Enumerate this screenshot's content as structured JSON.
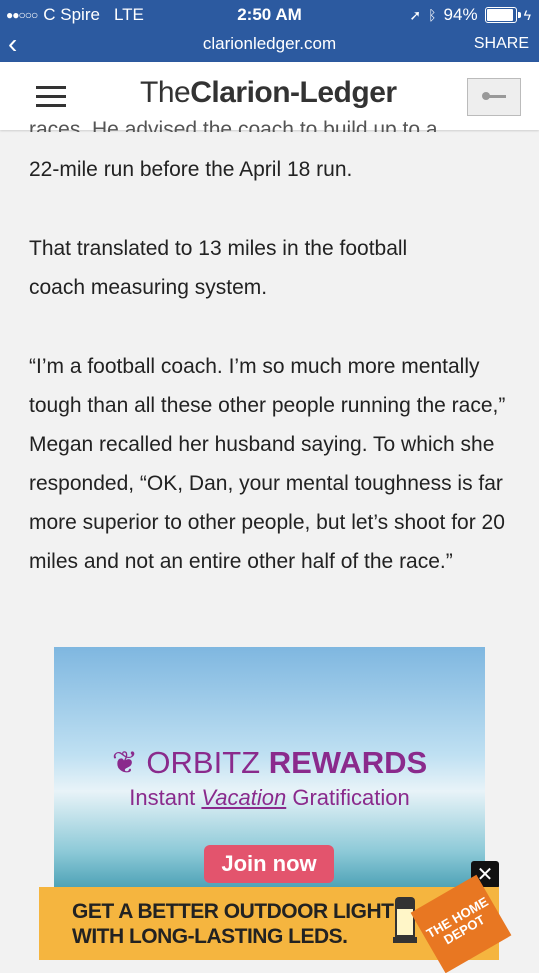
{
  "status": {
    "carrier": "C Spire",
    "network": "LTE",
    "time": "2:50 AM",
    "battery": "94%"
  },
  "browser": {
    "domain": "clarionledger.com",
    "share_label": "SHARE",
    "back_icon": "chevron-left-icon"
  },
  "site": {
    "logo_prefix": "The",
    "logo_brand": "Clarion-Ledger",
    "menu_icon": "hamburger-icon",
    "key_icon": "key-icon"
  },
  "article": {
    "cut_line": "races. He advised the coach to build up to a",
    "p1": "22-mile run before the April 18 run.",
    "p2": "That translated to 13 miles in the football coach measuring system.",
    "p3": "“I’m a football coach. I’m so much more mentally tough than all these other people running the race,” Megan recalled her husband saying. To which she responded, “OK, Dan, your mental toughness is far more superior to other people, but let’s shoot for 20 miles and not an entire other half of the race.”"
  },
  "ad": {
    "brand_light": "ORBITZ",
    "brand_bold": "REWARDS",
    "tagline_start": "Instant",
    "tagline_mid": "Vacation",
    "tagline_end": "Gratification",
    "cta": "Join now"
  },
  "banner": {
    "line1": "GET A BETTER OUTDOOR LIGHT",
    "line2": "WITH LONG-LASTING LEDS.",
    "logo_text": "THE HOME DEPOT",
    "close_label": "✕"
  }
}
